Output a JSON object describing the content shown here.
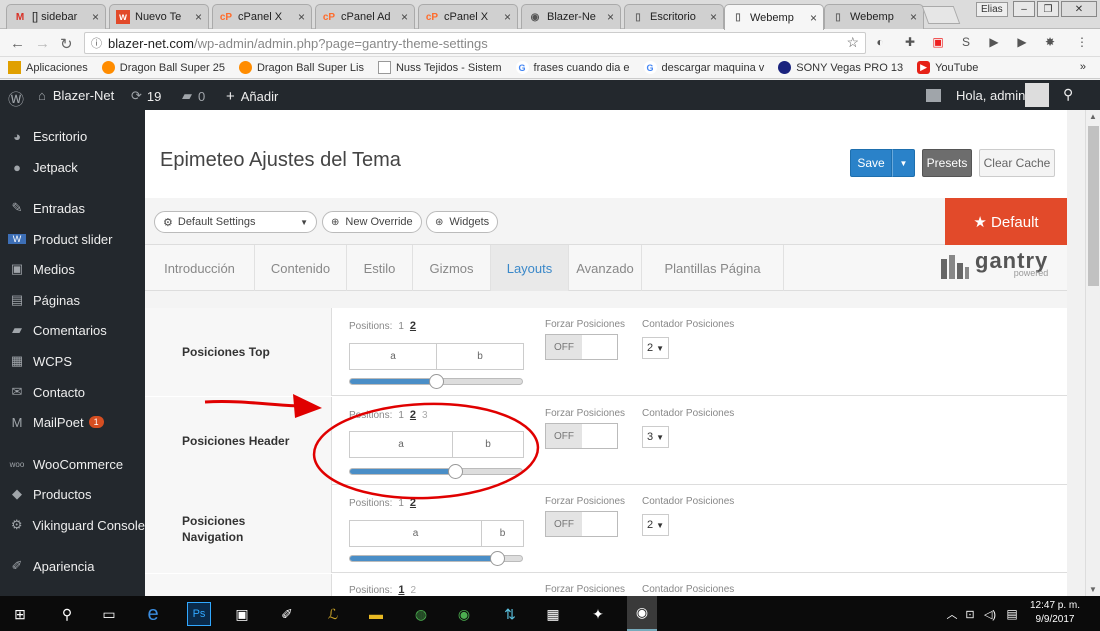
{
  "browser": {
    "tabs": [
      {
        "label": "[] sidebar",
        "icon": "gmail-icon"
      },
      {
        "label": "Nuevo Te",
        "icon": "w-icon"
      },
      {
        "label": "cPanel X",
        "icon": "cpanel-icon"
      },
      {
        "label": "cPanel Ad",
        "icon": "cpanel-icon"
      },
      {
        "label": "cPanel X",
        "icon": "cpanel-icon"
      },
      {
        "label": "Blazer-Ne",
        "icon": "wordpress-icon"
      },
      {
        "label": "Escritorio",
        "icon": "page-icon"
      },
      {
        "label": "Webemp",
        "icon": "page-icon"
      },
      {
        "label": "Webemp",
        "icon": "page-icon"
      }
    ],
    "active_tab": 7,
    "profile": "Elias",
    "url_host": "blazer-net.com",
    "url_path": "/wp-admin/admin.php?page=gantry-theme-settings",
    "bookmarks": [
      {
        "label": "Aplicaciones",
        "color": "#e0a000"
      },
      {
        "label": "Dragon Ball Super 25",
        "color": "#ff8c00"
      },
      {
        "label": "Dragon Ball Super Lis",
        "color": "#ff8c00"
      },
      {
        "label": "Nuss Tejidos - Sistem",
        "color": "#999999"
      },
      {
        "label": "frases cuando dia e",
        "color": "#4285f4"
      },
      {
        "label": "descargar maquina v",
        "color": "#4285f4"
      },
      {
        "label": "SONY Vegas PRO 13",
        "color": "#1a237e"
      },
      {
        "label": "YouTube",
        "color": "#e62117"
      }
    ]
  },
  "adminbar": {
    "site": "Blazer-Net",
    "updates": "19",
    "comments": "0",
    "add": "Añadir",
    "greeting": "Hola, admin"
  },
  "sidebar": {
    "items": [
      {
        "label": "Escritorio",
        "icon": "dashboard-icon"
      },
      {
        "label": "Jetpack",
        "icon": "jetpack-icon"
      },
      {
        "label": "Entradas",
        "icon": "pin-icon"
      },
      {
        "label": "Product slider",
        "icon": "slider-icon"
      },
      {
        "label": "Medios",
        "icon": "media-icon"
      },
      {
        "label": "Páginas",
        "icon": "pages-icon"
      },
      {
        "label": "Comentarios",
        "icon": "comment-icon"
      },
      {
        "label": "WCPS",
        "icon": "wcps-icon"
      },
      {
        "label": "Contacto",
        "icon": "mail-icon"
      },
      {
        "label": "MailPoet",
        "icon": "mailpoet-icon",
        "badge": "1"
      },
      {
        "label": "WooCommerce",
        "icon": "woo-icon"
      },
      {
        "label": "Productos",
        "icon": "box-icon"
      },
      {
        "label": "Vikinguard Console",
        "icon": "gear-icon"
      },
      {
        "label": "Apariencia",
        "icon": "brush-icon"
      }
    ]
  },
  "panel": {
    "title": "Epimeteo Ajustes del Tema",
    "save": "Save",
    "presets": "Presets",
    "clear_cache": "Clear Cache",
    "default_settings": "Default Settings",
    "new_override": "New Override",
    "widgets": "Widgets",
    "default_badge": "★ Default",
    "tabs": [
      "Introducción",
      "Contenido",
      "Estilo",
      "Gizmos",
      "Layouts",
      "Avanzado",
      "Plantillas Página"
    ],
    "active_tab": "Layouts",
    "logo_text": "gantry",
    "logo_sub": "powered"
  },
  "rows": [
    {
      "label": "Posiciones Top",
      "positions_label": "Positions:",
      "options": [
        "1",
        "2"
      ],
      "selected": "2",
      "boxes": [
        "a",
        "b"
      ],
      "slider": 0.5,
      "force_label": "Forzar Posiciones",
      "toggle": "OFF",
      "counter_label": "Contador Posiciones",
      "counter": "2"
    },
    {
      "label": "Posiciones Header",
      "positions_label": "Positions:",
      "options": [
        "1",
        "2",
        "3"
      ],
      "selected": "2",
      "boxes": [
        "a",
        "b"
      ],
      "slider": 0.6,
      "force_label": "Forzar Posiciones",
      "toggle": "OFF",
      "counter_label": "Contador Posiciones",
      "counter": "3"
    },
    {
      "label": "Posiciones Navigation",
      "positions_label": "Positions:",
      "options": [
        "1",
        "2"
      ],
      "selected": "2",
      "boxes": [
        "a",
        "b"
      ],
      "slider": 0.85,
      "force_label": "Forzar Posiciones",
      "toggle": "OFF",
      "counter_label": "Contador Posiciones",
      "counter": "2"
    },
    {
      "label": "",
      "positions_label": "Positions:",
      "options": [
        "1",
        "2"
      ],
      "selected": "1",
      "boxes": [],
      "force_label": "Forzar Posiciones",
      "toggle": "",
      "counter_label": "Contador Posiciones",
      "counter": ""
    }
  ],
  "taskbar": {
    "time": "12:47 p. m.",
    "date": "9/9/2017"
  },
  "colors": {
    "accent": "#2a82c9",
    "admin_bar": "#23282d",
    "default_badge": "#e24a2a",
    "annotation": "#e00000"
  }
}
